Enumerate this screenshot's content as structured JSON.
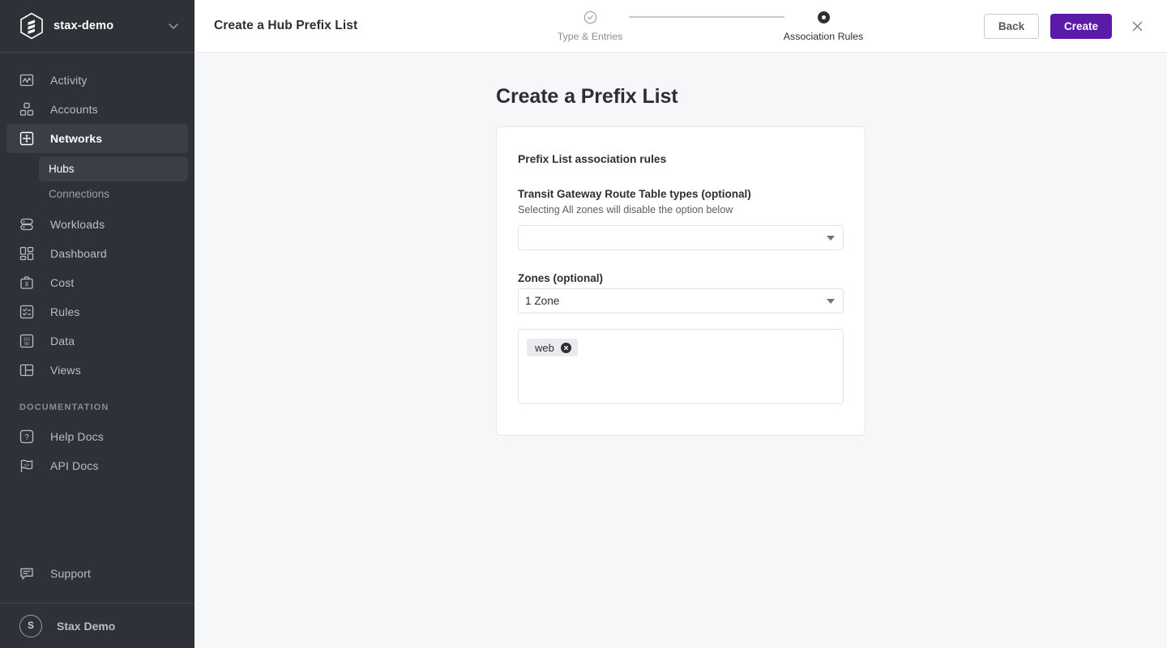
{
  "sidebar": {
    "org": {
      "name": "stax-demo",
      "logo_icon": "stax-hexagon-logo",
      "chevron_icon": "chevron-down-icon"
    },
    "items": [
      {
        "label": "Activity",
        "icon": "activity-chart-icon",
        "active": false
      },
      {
        "label": "Accounts",
        "icon": "accounts-grid-icon",
        "active": false
      },
      {
        "label": "Networks",
        "icon": "networks-move-icon",
        "active": true
      },
      {
        "label": "Workloads",
        "icon": "workloads-stack-icon",
        "active": false
      },
      {
        "label": "Dashboard",
        "icon": "dashboard-layout-icon",
        "active": false
      },
      {
        "label": "Cost",
        "icon": "cost-briefcase-icon",
        "active": false
      },
      {
        "label": "Rules",
        "icon": "rules-checklist-icon",
        "active": false
      },
      {
        "label": "Data",
        "icon": "data-binary-icon",
        "active": false
      },
      {
        "label": "Views",
        "icon": "views-panel-icon",
        "active": false
      }
    ],
    "subitems": [
      {
        "label": "Hubs",
        "active": true
      },
      {
        "label": "Connections",
        "active": false
      }
    ],
    "documentation_label": "DOCUMENTATION",
    "doc_items": [
      {
        "label": "Help Docs",
        "icon": "question-mark-icon"
      },
      {
        "label": "API Docs",
        "icon": "code-flag-icon"
      }
    ],
    "support": {
      "label": "Support",
      "icon": "chat-bubble-icon"
    },
    "user": {
      "name": "Stax Demo",
      "initial": "S"
    }
  },
  "topbar": {
    "title": "Create a Hub Prefix List",
    "back_label": "Back",
    "create_label": "Create",
    "close_icon": "close-icon",
    "steps": [
      {
        "label": "Type & Entries",
        "state": "complete",
        "icon": "check-circle-icon"
      },
      {
        "label": "Association Rules",
        "state": "current",
        "icon": "filled-dot-icon"
      }
    ]
  },
  "main": {
    "page_title": "Create a Prefix List",
    "card": {
      "heading": "Prefix List association rules",
      "tgw_field": {
        "label": "Transit Gateway Route Table types (optional)",
        "help": "Selecting All zones will disable the option below",
        "value": "",
        "caret_icon": "caret-down-icon"
      },
      "zones_field": {
        "label": "Zones (optional)",
        "value": "1 Zone",
        "caret_icon": "caret-down-icon"
      },
      "chips": [
        {
          "label": "web",
          "remove_icon": "chip-remove-icon"
        }
      ]
    }
  },
  "colors": {
    "sidebar_bg": "#2e3138",
    "sidebar_active": "#3a3e46",
    "accent_purple": "#5b1ba8",
    "page_bg": "#f6f7f9",
    "card_bg": "#ffffff",
    "border": "#e4e7eb",
    "text_dark": "#2c2f36",
    "text_muted": "#8a8f98"
  }
}
